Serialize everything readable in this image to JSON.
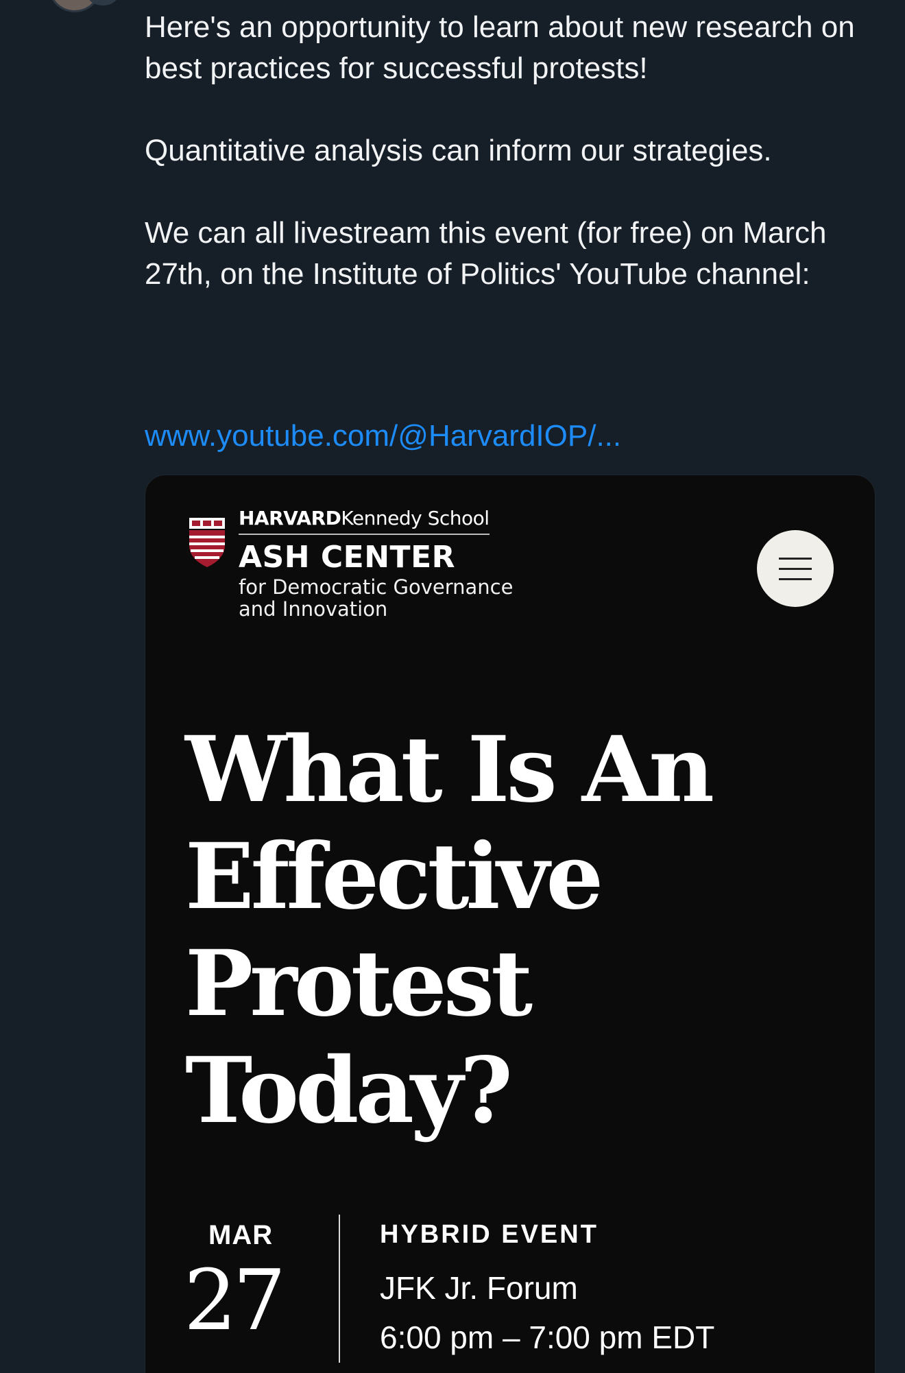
{
  "post": {
    "paragraphs": [
      "Here's an opportunity to learn about new research on best practices for successful protests!",
      "Quantitative analysis can inform our strategies.",
      "We can all livestream this event (for free) on March 27th, on the Institute of Politics' YouTube channel:"
    ],
    "link": "www.youtube.com/@HarvardIOP/..."
  },
  "card": {
    "logo": {
      "hks_bold": "HARVARD",
      "hks_regular": "Kennedy School",
      "center": "ASH CENTER",
      "subtitle": "for Democratic Governance and Innovation"
    },
    "headline_lines": [
      "What Is An",
      "Effective",
      "Protest",
      "Today?"
    ],
    "date": {
      "month": "MAR",
      "day": "27"
    },
    "event": {
      "type": "HYBRID EVENT",
      "venue": "JFK Jr. Forum",
      "time": "6:00 pm – 7:00 pm EDT"
    }
  },
  "colors": {
    "background": "#161e27",
    "link": "#1d8cf8",
    "card_background": "#0b0b0b",
    "shield_red": "#a51c30"
  },
  "icons": {
    "menu": "hamburger-icon",
    "shield": "harvard-shield-icon"
  }
}
